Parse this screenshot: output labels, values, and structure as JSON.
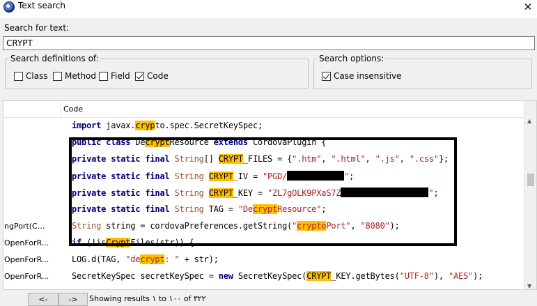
{
  "window": {
    "title": "Text search",
    "close_symbol": "✕"
  },
  "search": {
    "label": "Search for text:",
    "value": "CRYPT"
  },
  "definitions": {
    "legend": "Search definitions of:",
    "options": [
      {
        "label": "Class",
        "checked": false
      },
      {
        "label": "Method",
        "checked": false
      },
      {
        "label": "Field",
        "checked": false
      },
      {
        "label": "Code",
        "checked": true
      }
    ]
  },
  "search_options": {
    "legend": "Search options:",
    "options": [
      {
        "label": "Case insensitive",
        "checked": true
      }
    ]
  },
  "results": {
    "column_header": "Code",
    "rows": [
      {
        "node": "",
        "code": [
          {
            "t": "import",
            "c": "kw"
          },
          {
            "t": " javax."
          },
          {
            "t": "cryp",
            "c": "hl"
          },
          {
            "t": "to.spec.SecretKeySpec;"
          }
        ]
      },
      {
        "node": "",
        "code": [
          {
            "t": "public class",
            "c": "kw"
          },
          {
            "t": " De"
          },
          {
            "t": "crypt",
            "c": "hl"
          },
          {
            "t": "Resource "
          },
          {
            "t": "extends",
            "c": "kw"
          },
          {
            "t": " CordovaPlugin {"
          }
        ]
      },
      {
        "node": "",
        "code": [
          {
            "t": "private static final",
            "c": "kw"
          },
          {
            "t": " "
          },
          {
            "t": "String",
            "c": "ty"
          },
          {
            "t": "[] "
          },
          {
            "t": "CRYPT",
            "c": "hl"
          },
          {
            "t": "_FILES = {"
          },
          {
            "t": "\".htm\"",
            "c": "st"
          },
          {
            "t": ", "
          },
          {
            "t": "\".html\"",
            "c": "st"
          },
          {
            "t": ", "
          },
          {
            "t": "\".js\"",
            "c": "st"
          },
          {
            "t": ", "
          },
          {
            "t": "\".css\"",
            "c": "st"
          },
          {
            "t": "};"
          }
        ]
      },
      {
        "node": "",
        "code": [
          {
            "t": "private static final",
            "c": "kw"
          },
          {
            "t": " "
          },
          {
            "t": "String",
            "c": "ty"
          },
          {
            "t": " "
          },
          {
            "t": "CRYPT",
            "c": "hl"
          },
          {
            "t": "_IV = "
          },
          {
            "t": "\"PGD/",
            "c": "st"
          },
          {
            "t": "",
            "c": "redact"
          },
          {
            "t": "\"",
            "c": "st"
          },
          {
            "t": ";"
          }
        ]
      },
      {
        "node": "",
        "code": [
          {
            "t": "private static final",
            "c": "kw"
          },
          {
            "t": " "
          },
          {
            "t": "String",
            "c": "ty"
          },
          {
            "t": " "
          },
          {
            "t": "CRYPT",
            "c": "hl"
          },
          {
            "t": "_KEY = "
          },
          {
            "t": "\"ZL7gOLK9PXaS7Z",
            "c": "st"
          },
          {
            "t": "",
            "c": "redact long"
          },
          {
            "t": "\"",
            "c": "st"
          },
          {
            "t": ";"
          }
        ]
      },
      {
        "node": "",
        "code": [
          {
            "t": "private static final",
            "c": "kw"
          },
          {
            "t": " "
          },
          {
            "t": "String",
            "c": "ty"
          },
          {
            "t": " TAG = "
          },
          {
            "t": "\"De",
            "c": "st"
          },
          {
            "t": "crypt",
            "c": "hl st"
          },
          {
            "t": "Resource\"",
            "c": "st"
          },
          {
            "t": ";"
          }
        ]
      },
      {
        "node": "ngPort(C...",
        "code": [
          {
            "t": "String",
            "c": "ty"
          },
          {
            "t": " string = cordovaPreferences.getString("
          },
          {
            "t": "\"",
            "c": "st"
          },
          {
            "t": "crypto",
            "c": "hl st"
          },
          {
            "t": "Port\"",
            "c": "st"
          },
          {
            "t": ", "
          },
          {
            "t": "\"8080\"",
            "c": "st"
          },
          {
            "t": ");"
          }
        ]
      },
      {
        "node": "OpenForR...",
        "code": [
          {
            "t": "if",
            "c": "kw"
          },
          {
            "t": " (!is"
          },
          {
            "t": "Crypt",
            "c": "hl"
          },
          {
            "t": "Files(str)) {"
          }
        ]
      },
      {
        "node": "OpenForR...",
        "code": [
          {
            "t": "LOG.d(TAG, "
          },
          {
            "t": "\"de",
            "c": "st"
          },
          {
            "t": "crypt",
            "c": "hl st"
          },
          {
            "t": ": \"",
            "c": "st"
          },
          {
            "t": " + str);"
          }
        ]
      },
      {
        "node": "OpenForR...",
        "code": [
          {
            "t": "SecretKeySpec secretKeySpec = "
          },
          {
            "t": "new",
            "c": "kw"
          },
          {
            "t": " SecretKeySpec("
          },
          {
            "t": "CRYPT",
            "c": "hl"
          },
          {
            "t": "_KEY.getBytes("
          },
          {
            "t": "\"UTF-8\"",
            "c": "st"
          },
          {
            "t": "), "
          },
          {
            "t": "\"AES\"",
            "c": "st"
          },
          {
            "t": ");"
          }
        ]
      }
    ]
  },
  "footer": {
    "prev_label": "<-",
    "next_label": "->",
    "status": "Showing results ١ to ١٠٠ of ٣٢٢"
  },
  "scrollbar": {
    "up_symbol": "▲",
    "down_symbol": "▼"
  },
  "colors": {
    "highlight": "#ffc000",
    "keyword": "#000080",
    "type": "#a0522d",
    "string": "#b22222"
  }
}
